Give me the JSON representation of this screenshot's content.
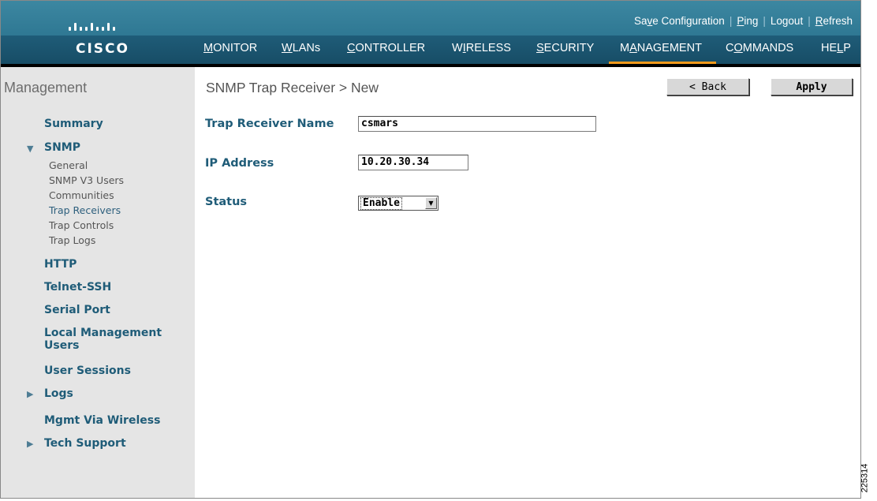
{
  "header": {
    "brand": "CISCO",
    "top_links": {
      "save_pre": "Sa",
      "save_ul": "v",
      "save_post": "e Configuration",
      "ping_ul": "P",
      "ping_post": "ing",
      "logout_pre": "Lo",
      "logout_ul": "g",
      "logout_post": "out",
      "refresh_ul": "R",
      "refresh_post": "efresh"
    },
    "tabs": [
      {
        "ul": "M",
        "rest": "ONITOR"
      },
      {
        "ul": "W",
        "rest": "LANs"
      },
      {
        "ul": "C",
        "rest": "ONTROLLER"
      },
      {
        "pre": "W",
        "ul": "I",
        "rest": "RELESS"
      },
      {
        "ul": "S",
        "rest": "ECURITY"
      },
      {
        "pre": "M",
        "ul": "A",
        "rest": "NAGEMENT"
      },
      {
        "pre": "C",
        "ul": "O",
        "rest": "MMANDS"
      },
      {
        "pre": "HE",
        "ul": "L",
        "rest": "P"
      }
    ],
    "active_tab": "MANAGEMENT",
    "colors": {
      "topbar": "#3c87a1",
      "navbar": "#1f5c78",
      "active_underline": "#f29a1c"
    }
  },
  "sidebar": {
    "title": "Management",
    "items": [
      {
        "label": "Summary"
      },
      {
        "label": "SNMP",
        "expanded": true,
        "children": [
          "General",
          "SNMP V3 Users",
          "Communities",
          "Trap Receivers",
          "Trap Controls",
          "Trap Logs"
        ],
        "active_child": "Trap Receivers"
      },
      {
        "label": "HTTP"
      },
      {
        "label": "Telnet-SSH"
      },
      {
        "label": "Serial Port"
      },
      {
        "label": "Local Management",
        "label2": "Users"
      },
      {
        "label": "User Sessions"
      },
      {
        "label": "Logs",
        "collapsed": true
      },
      {
        "label": "Mgmt Via Wireless"
      },
      {
        "label": "Tech Support",
        "collapsed": true
      }
    ],
    "icons": {
      "expanded": "triangle-down-icon",
      "collapsed": "triangle-right-icon"
    }
  },
  "main": {
    "title": "SNMP Trap Receiver > New",
    "back_label": "< Back",
    "apply_label": "Apply",
    "fields": {
      "name_label": "Trap Receiver Name",
      "name_value": "csmars",
      "ip_label": "IP Address",
      "ip_value": "10.20.30.34",
      "status_label": "Status",
      "status_value": "Enable"
    }
  },
  "figure_code": "225314"
}
